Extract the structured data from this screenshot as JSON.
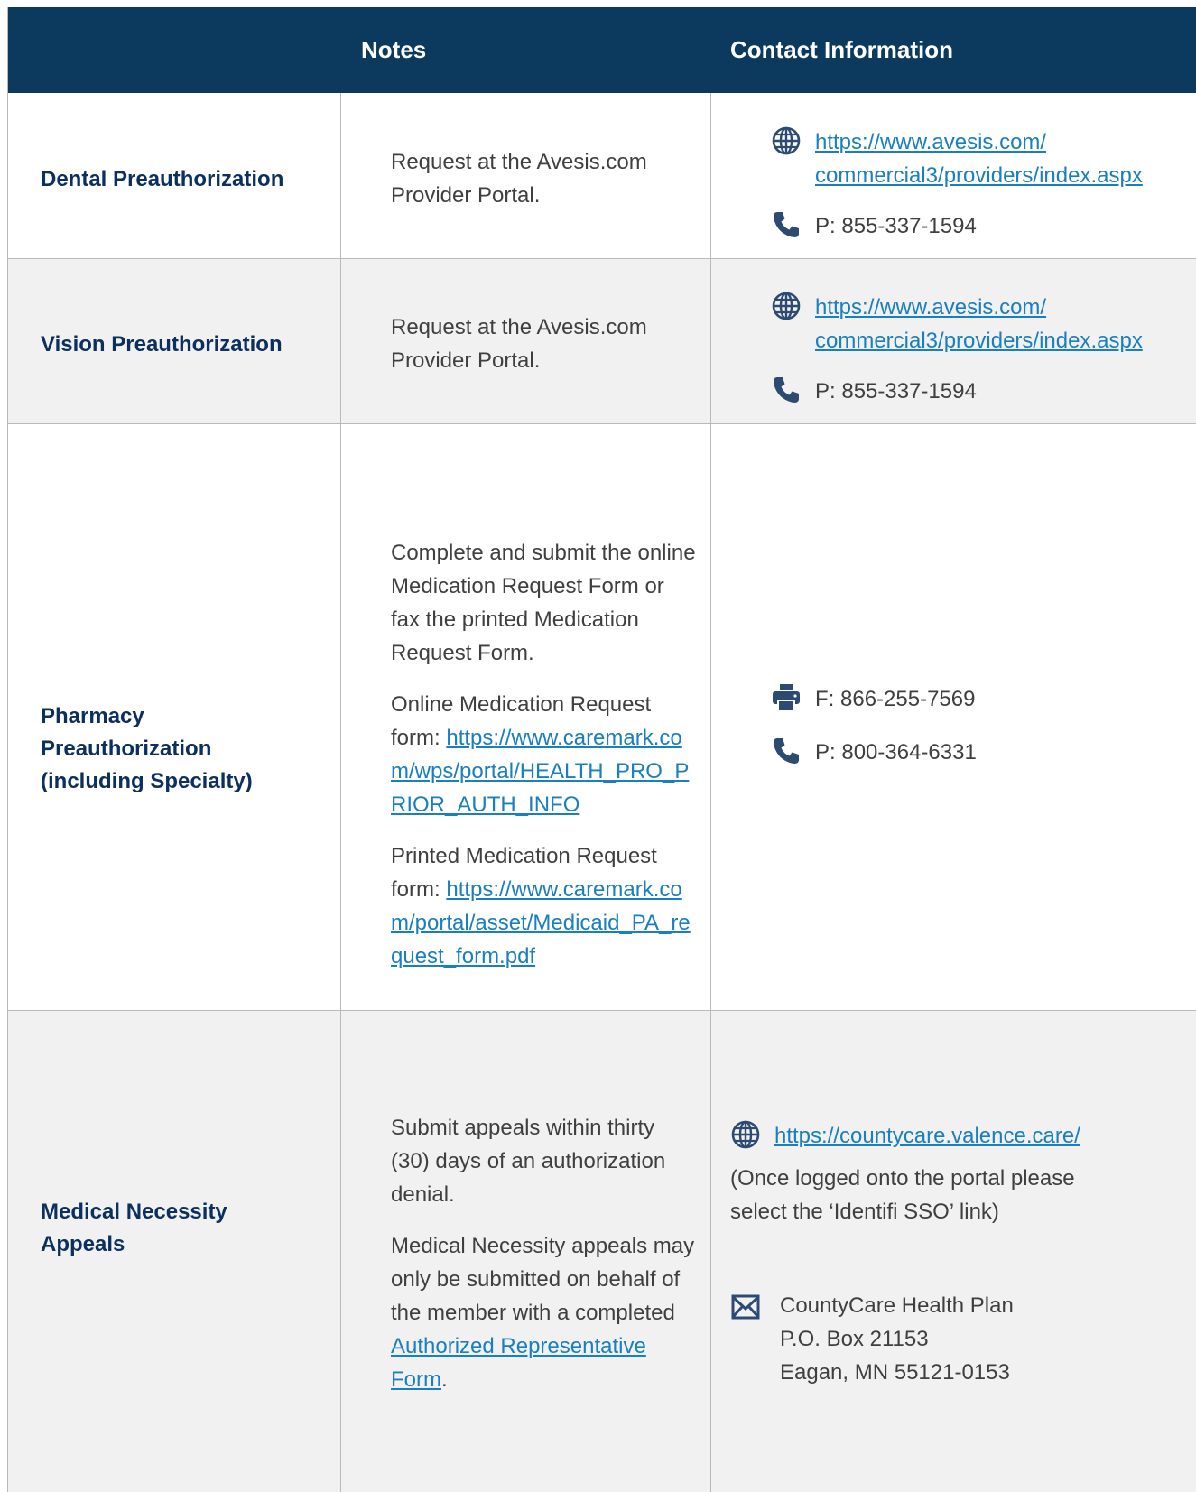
{
  "header": {
    "notes": "Notes",
    "contact": "Contact Information"
  },
  "rows": [
    {
      "service": "Dental Preauthorization",
      "note": "Request at the Avesis.com Provider Portal.",
      "web_line1": "https://www.avesis.com/",
      "web_line2": "commercial3/providers/index.aspx",
      "phone": "P: 855-337-1594"
    },
    {
      "service": "Vision Preauthorization",
      "note": "Request at the Avesis.com Provider Portal.",
      "web_line1": "https://www.avesis.com/",
      "web_line2": "commercial3/providers/index.aspx",
      "phone": "P: 855-337-1594"
    },
    {
      "service_line1": "Pharmacy",
      "service_line2": "Preauthorization",
      "service_line3": "(including Specialty)",
      "note1": "Complete and submit the online Medication Request Form or fax the printed Medication Request Form.",
      "note2_prefix": "Online Medication Request form: ",
      "note2_link": "https://www.caremark.com/wps/portal/HEALTH_PRO_PRIOR_AUTH_INFO",
      "note3_prefix": "Printed Medication Request form: ",
      "note3_link": "https://www.caremark.com/portal/asset/Medicaid_PA_request_form.pdf",
      "fax": "F: 866-255-7569",
      "phone": "P: 800-364-6331"
    },
    {
      "service_line1": "Medical Necessity",
      "service_line2": "Appeals",
      "note1": "Submit appeals within thirty (30) days of an authorization denial.",
      "note2_prefix": "Medical Necessity appeals may only be submitted on behalf of the member with a completed ",
      "note2_link": "Authorized Representative Form",
      "note2_suffix": ".",
      "web": "https://countycare.valence.care/",
      "portal_note": "(Once logged onto the portal please select the ‘Identifi SSO’ link)",
      "mail_line1": "CountyCare Health Plan",
      "mail_line2": "P.O. Box 21153",
      "mail_line3": "Eagan, MN 55121-0153"
    }
  ],
  "icons": {
    "web": "globe-icon",
    "phone": "phone-icon",
    "fax": "fax-icon",
    "mail": "mail-icon",
    "color": "#2d4a73"
  }
}
